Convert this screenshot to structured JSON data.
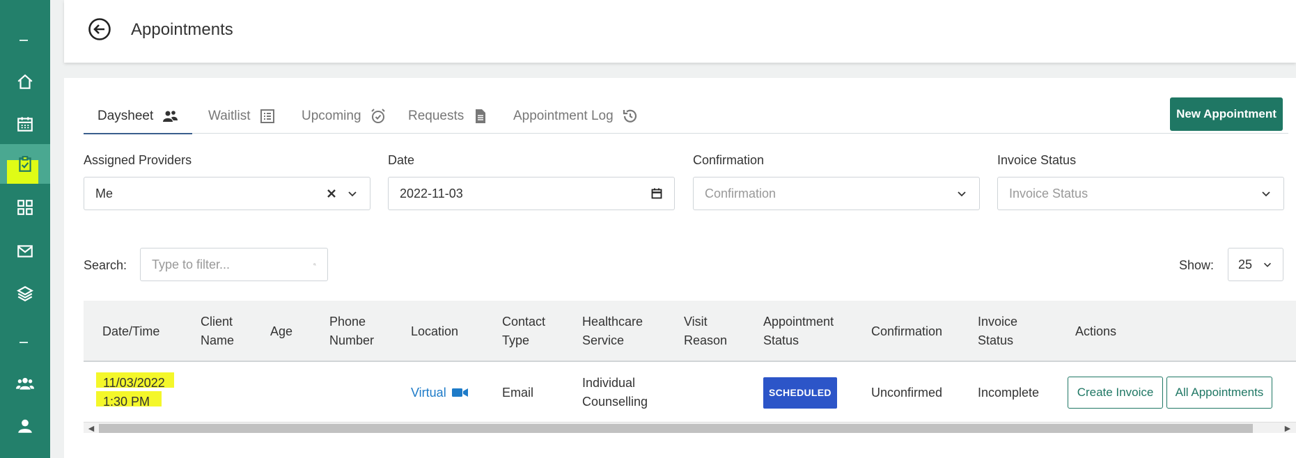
{
  "header": {
    "title": "Appointments"
  },
  "sidebar": {
    "items": [
      {
        "icon": "home-icon"
      },
      {
        "icon": "calendar-icon"
      },
      {
        "icon": "clipboard-check-icon",
        "active": true
      },
      {
        "icon": "grid-icon"
      },
      {
        "icon": "mail-icon"
      },
      {
        "icon": "layers-icon"
      },
      {
        "icon": "group-icon"
      },
      {
        "icon": "user-icon"
      }
    ]
  },
  "tabs": [
    {
      "label": "Daysheet",
      "icon": "people-icon",
      "active": true
    },
    {
      "label": "Waitlist",
      "icon": "list-icon"
    },
    {
      "label": "Upcoming",
      "icon": "alarm-clock-icon"
    },
    {
      "label": "Requests",
      "icon": "document-icon"
    },
    {
      "label": "Appointment Log",
      "icon": "history-icon"
    }
  ],
  "new_appointment_label": "New Appointment",
  "filters": {
    "providers": {
      "label": "Assigned Providers",
      "value": "Me"
    },
    "date": {
      "label": "Date",
      "value": "2022-11-03"
    },
    "confirmation": {
      "label": "Confirmation",
      "placeholder": "Confirmation"
    },
    "invoice": {
      "label": "Invoice Status",
      "placeholder": "Invoice Status"
    }
  },
  "search": {
    "label": "Search:",
    "placeholder": "Type to filter..."
  },
  "show": {
    "label": "Show:",
    "value": "25"
  },
  "table": {
    "headers": [
      "Date/Time",
      "Client Name",
      "Age",
      "Phone Number",
      "Location",
      "Contact Type",
      "Healthcare Service",
      "Visit Reason",
      "Appointment Status",
      "Confirmation",
      "Invoice Status",
      "Actions"
    ],
    "rows": [
      {
        "date": "11/03/2022",
        "time": "1:30 PM",
        "location": "Virtual",
        "contact_type": "Email",
        "service": "Individual Counselling",
        "status": "SCHEDULED",
        "confirmation": "Unconfirmed",
        "invoice_status": "Incomplete",
        "action_create": "Create Invoice",
        "action_all": "All Appointments"
      }
    ]
  },
  "colors": {
    "sidebar": "#23806b",
    "accent": "#1f7764",
    "highlight": "#f4f72a",
    "badge": "#2c55c8",
    "link": "#1e7bc8"
  }
}
